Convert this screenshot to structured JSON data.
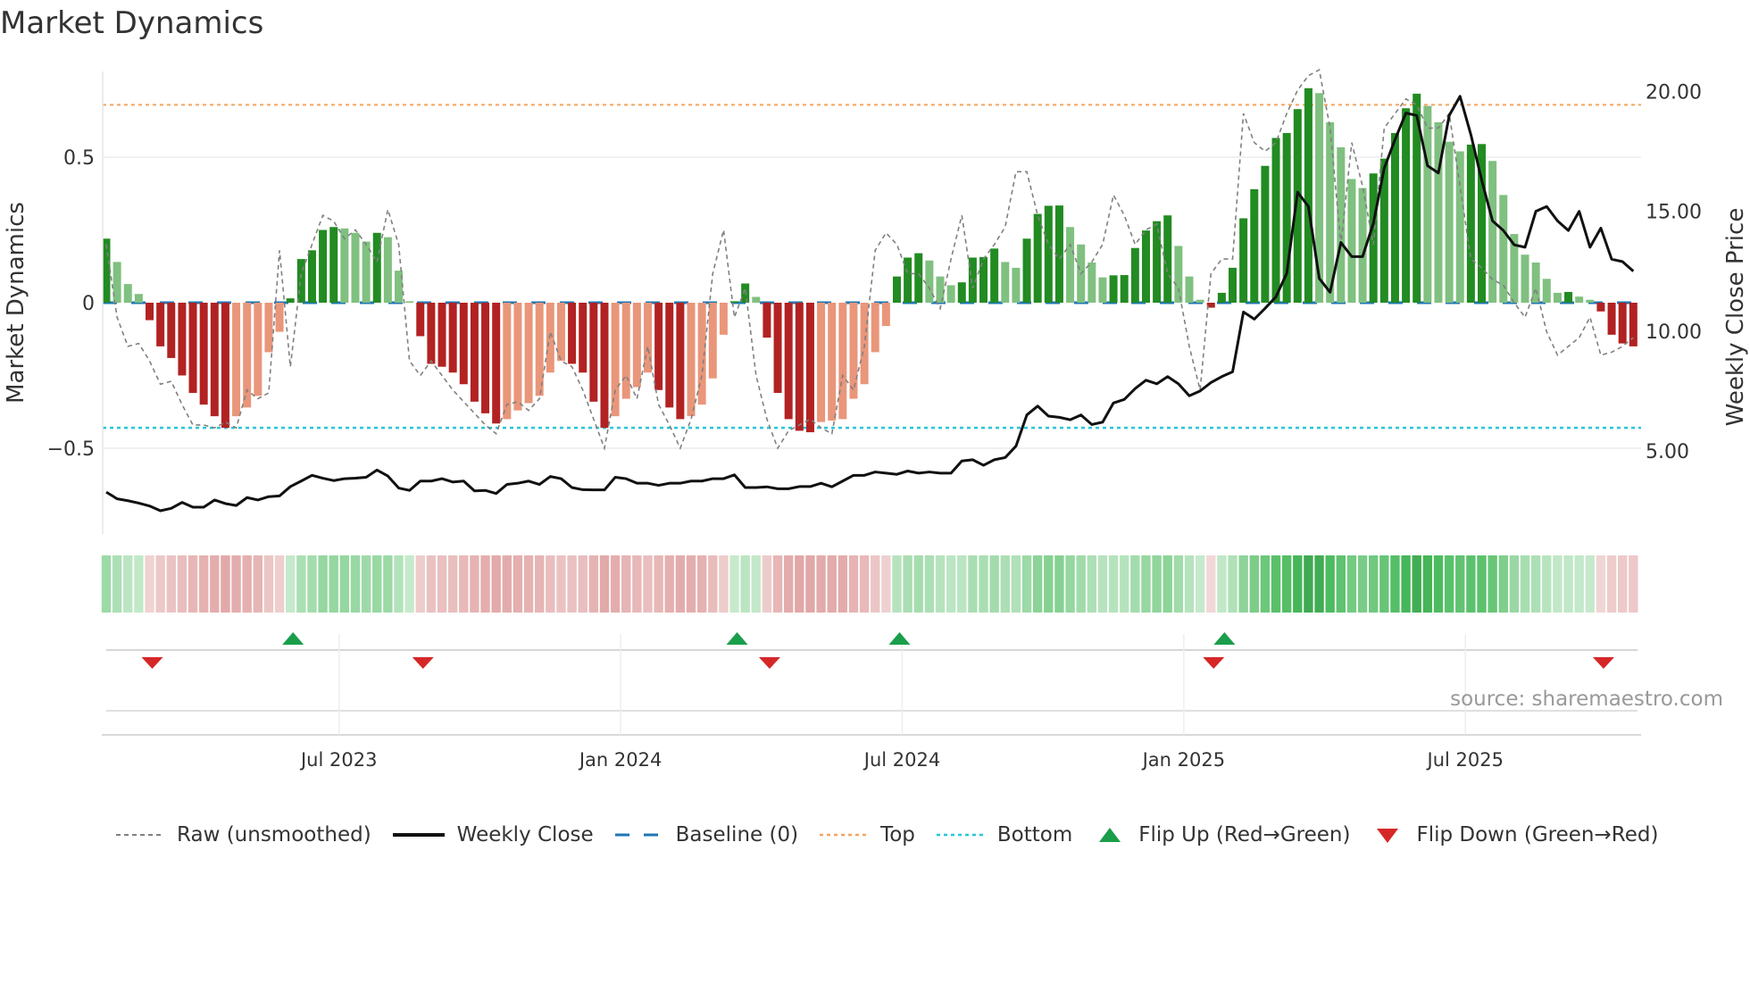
{
  "title": "Market Dynamics",
  "source": "source: sharemaestro.com",
  "legend": {
    "raw": "Raw (unsmoothed)",
    "close": "Weekly Close",
    "baseline": "Baseline (0)",
    "top": "Top",
    "bottom": "Bottom",
    "flip_up": "Flip Up (Red→Green)",
    "flip_down": "Flip Down (Green→Red)"
  },
  "colors": {
    "pos_rising": "#228b22",
    "pos_falling": "#80c080",
    "neg_falling": "#b22222",
    "neg_rising": "#e9967a",
    "raw": "#808080",
    "close": "#111111",
    "baseline": "#1f77b4",
    "top": "#f4a460",
    "bottom": "#26c6da",
    "flip_up": "#1a9e4a",
    "flip_down": "#d62728"
  },
  "chart_data": {
    "type": "bar",
    "title": "Market Dynamics",
    "xlabel": "",
    "ylabel": "Market Dynamics",
    "ylabel_right": "Weekly Close Price",
    "ylim": [
      -0.8,
      0.79
    ],
    "ylim_right": [
      1.0,
      21.0
    ],
    "yticks": [
      {
        "v": 0.5,
        "label": "0.5"
      },
      {
        "v": 0,
        "label": "0"
      },
      {
        "v": -0.5,
        "label": "−0.5"
      }
    ],
    "yticks_right": [
      {
        "v": 20,
        "label": "20.00"
      },
      {
        "v": 15,
        "label": "15.00"
      },
      {
        "v": 10,
        "label": "10.00"
      },
      {
        "v": 5,
        "label": "5.00"
      }
    ],
    "xticks": [
      {
        "i": 21,
        "label": "Jul 2023"
      },
      {
        "i": 47,
        "label": "Jan 2024"
      },
      {
        "i": 73,
        "label": "Jul 2024"
      },
      {
        "i": 99,
        "label": "Jan 2025"
      },
      {
        "i": 125,
        "label": "Jul 2025"
      }
    ],
    "top_level": 0.68,
    "bottom_level": -0.43,
    "baseline": 0,
    "dynamics": [
      0.22,
      0.14,
      0.064,
      0.03,
      -0.06,
      -0.15,
      -0.19,
      -0.25,
      -0.31,
      -0.35,
      -0.39,
      -0.43,
      -0.39,
      -0.36,
      -0.32,
      -0.17,
      -0.1,
      0.015,
      0.15,
      0.18,
      0.25,
      0.26,
      0.255,
      0.24,
      0.21,
      0.24,
      0.225,
      0.11,
      0.005,
      -0.115,
      -0.21,
      -0.22,
      -0.24,
      -0.28,
      -0.34,
      -0.38,
      -0.415,
      -0.4,
      -0.37,
      -0.345,
      -0.32,
      -0.24,
      -0.2,
      -0.21,
      -0.24,
      -0.34,
      -0.43,
      -0.39,
      -0.33,
      -0.29,
      -0.24,
      -0.3,
      -0.36,
      -0.4,
      -0.39,
      -0.35,
      -0.26,
      -0.11,
      0.005,
      0.066,
      0.02,
      -0.12,
      -0.31,
      -0.4,
      -0.44,
      -0.445,
      -0.41,
      -0.405,
      -0.4,
      -0.33,
      -0.28,
      -0.17,
      -0.08,
      0.09,
      0.155,
      0.17,
      0.145,
      0.09,
      0.06,
      0.07,
      0.155,
      0.157,
      0.186,
      0.14,
      0.12,
      0.22,
      0.305,
      0.333,
      0.334,
      0.26,
      0.2,
      0.138,
      0.087,
      0.094,
      0.095,
      0.188,
      0.248,
      0.28,
      0.3,
      0.195,
      0.09,
      0.01,
      -0.017,
      0.034,
      0.12,
      0.29,
      0.39,
      0.47,
      0.566,
      0.583,
      0.665,
      0.737,
      0.72,
      0.62,
      0.534,
      0.425,
      0.394,
      0.444,
      0.495,
      0.583,
      0.668,
      0.718,
      0.676,
      0.62,
      0.553,
      0.52,
      0.543,
      0.545,
      0.487,
      0.37,
      0.236,
      0.165,
      0.138,
      0.082,
      0.034,
      0.037,
      0.021,
      0.01,
      -0.03,
      -0.11,
      -0.14,
      -0.15
    ],
    "raw": [
      0.2,
      -0.05,
      -0.15,
      -0.14,
      -0.2,
      -0.28,
      -0.27,
      -0.35,
      -0.42,
      -0.42,
      -0.43,
      -0.41,
      -0.43,
      -0.3,
      -0.33,
      -0.31,
      0.18,
      -0.22,
      0.1,
      0.2,
      0.3,
      0.28,
      0.22,
      0.25,
      0.2,
      0.14,
      0.32,
      0.2,
      -0.2,
      -0.25,
      -0.2,
      -0.25,
      -0.3,
      -0.34,
      -0.38,
      -0.42,
      -0.45,
      -0.35,
      -0.34,
      -0.37,
      -0.33,
      -0.1,
      -0.2,
      -0.22,
      -0.3,
      -0.4,
      -0.5,
      -0.3,
      -0.25,
      -0.33,
      -0.15,
      -0.35,
      -0.42,
      -0.5,
      -0.4,
      -0.25,
      0.1,
      0.25,
      -0.05,
      0.05,
      -0.25,
      -0.4,
      -0.5,
      -0.44,
      -0.42,
      -0.4,
      -0.43,
      -0.45,
      -0.25,
      -0.3,
      -0.15,
      0.18,
      0.24,
      0.2,
      0.1,
      0.1,
      0.05,
      -0.02,
      0.15,
      0.3,
      0.05,
      0.15,
      0.2,
      0.26,
      0.45,
      0.45,
      0.3,
      0.2,
      0.15,
      0.2,
      0.1,
      0.14,
      0.2,
      0.37,
      0.3,
      0.2,
      0.25,
      0.27,
      0.1,
      0.05,
      -0.15,
      -0.3,
      0.1,
      0.15,
      0.15,
      0.65,
      0.55,
      0.52,
      0.55,
      0.65,
      0.73,
      0.78,
      0.8,
      0.6,
      0.2,
      0.55,
      0.4,
      0.2,
      0.6,
      0.65,
      0.7,
      0.68,
      0.6,
      0.6,
      0.65,
      0.4,
      0.15,
      0.12,
      0.08,
      0.06,
      0.0,
      -0.05,
      0.05,
      -0.1,
      -0.18,
      -0.15,
      -0.12,
      -0.05,
      -0.18,
      -0.17,
      -0.15,
      -0.12
    ],
    "close": [
      3.28,
      3.0,
      2.92,
      2.82,
      2.7,
      2.5,
      2.6,
      2.85,
      2.65,
      2.65,
      2.95,
      2.8,
      2.72,
      3.05,
      2.95,
      3.09,
      3.12,
      3.51,
      3.74,
      3.98,
      3.86,
      3.76,
      3.84,
      3.86,
      3.9,
      4.2,
      3.95,
      3.45,
      3.35,
      3.74,
      3.74,
      3.84,
      3.7,
      3.74,
      3.33,
      3.35,
      3.22,
      3.6,
      3.65,
      3.74,
      3.6,
      3.93,
      3.84,
      3.47,
      3.38,
      3.37,
      3.37,
      3.9,
      3.84,
      3.65,
      3.65,
      3.56,
      3.65,
      3.65,
      3.74,
      3.74,
      3.84,
      3.84,
      4.0,
      3.47,
      3.47,
      3.5,
      3.42,
      3.42,
      3.51,
      3.51,
      3.65,
      3.5,
      3.74,
      3.98,
      3.98,
      4.12,
      4.07,
      4.02,
      4.16,
      4.07,
      4.12,
      4.07,
      4.07,
      4.58,
      4.63,
      4.4,
      4.63,
      4.72,
      5.2,
      6.5,
      6.87,
      6.45,
      6.4,
      6.3,
      6.5,
      6.1,
      6.2,
      7.0,
      7.15,
      7.6,
      7.95,
      7.8,
      8.1,
      7.8,
      7.3,
      7.5,
      7.85,
      8.1,
      8.3,
      10.8,
      10.5,
      10.95,
      11.43,
      12.41,
      15.8,
      15.2,
      12.2,
      11.62,
      13.7,
      13.11,
      13.11,
      14.5,
      16.8,
      18.0,
      19.1,
      19.0,
      16.9,
      16.6,
      19.0,
      19.8,
      18.2,
      16.3,
      14.6,
      14.2,
      13.6,
      13.5,
      15.0,
      15.2,
      14.6,
      14.2,
      15.0,
      13.5,
      14.3,
      13.0,
      12.9,
      12.5
    ],
    "flips_up": [
      17,
      58,
      73,
      103
    ],
    "flips_down": [
      4,
      29,
      61,
      102,
      138
    ]
  }
}
